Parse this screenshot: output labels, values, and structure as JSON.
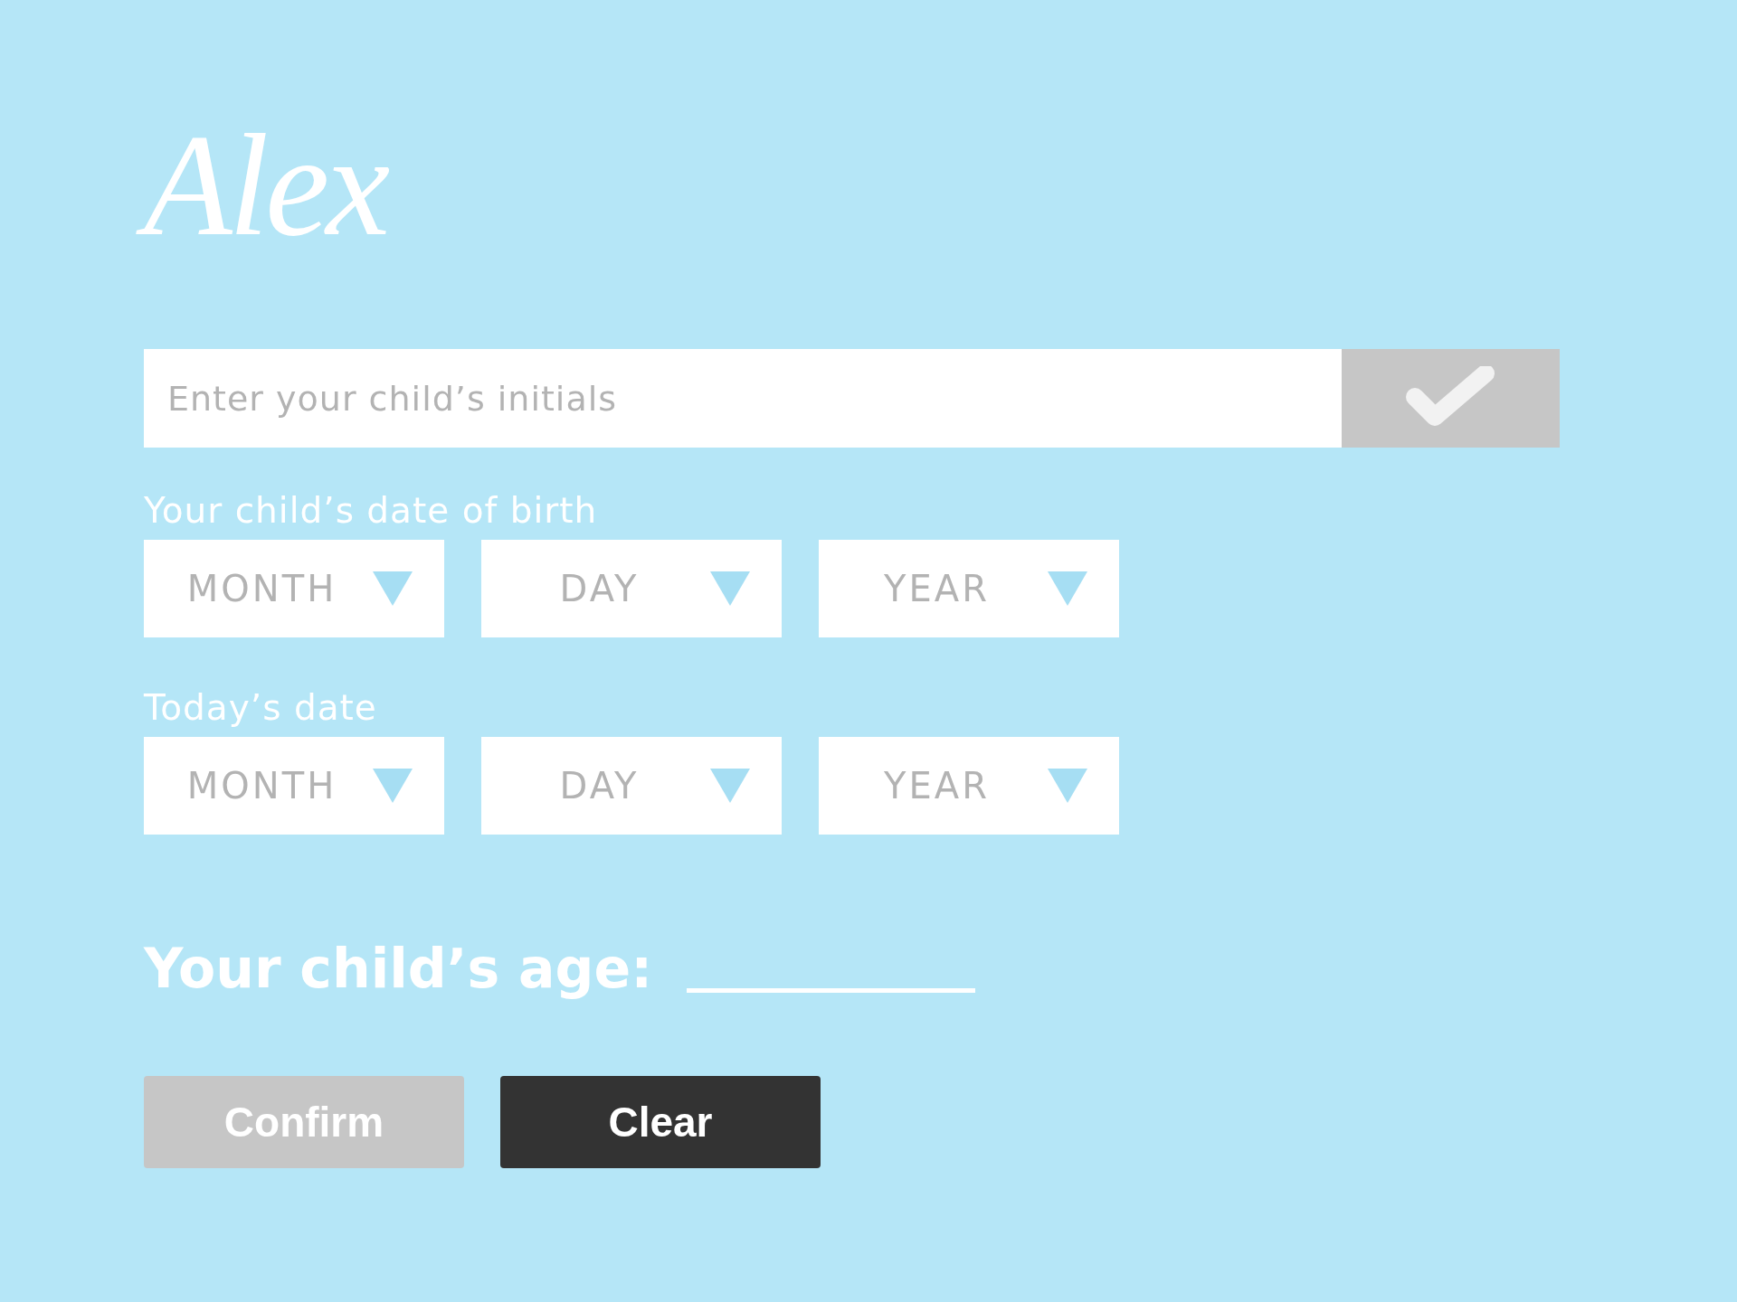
{
  "logo": {
    "text": "Alex"
  },
  "initials": {
    "placeholder": "Enter your child’s initials"
  },
  "birth_date": {
    "label": "Your child’s date of birth",
    "dropdowns": [
      {
        "placeholder": "MONTH"
      },
      {
        "placeholder": "DAY"
      },
      {
        "placeholder": "YEAR"
      }
    ]
  },
  "todays_date": {
    "label": "Today’s date",
    "dropdowns": [
      {
        "placeholder": "MONTH"
      },
      {
        "placeholder": "DAY"
      },
      {
        "placeholder": "YEAR"
      }
    ]
  },
  "age": {
    "label": "Your child’s age:"
  },
  "buttons": [
    {
      "label": "Confirm",
      "disabled": true
    },
    {
      "label": "Clear",
      "disabled": false
    }
  ]
}
